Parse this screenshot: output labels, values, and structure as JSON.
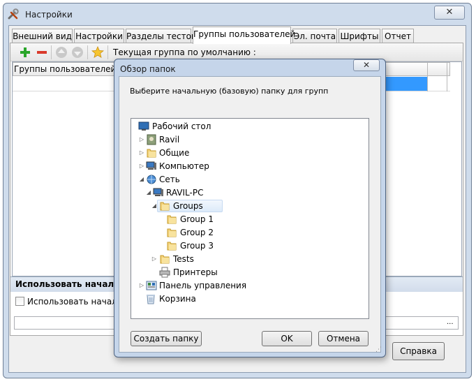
{
  "window": {
    "title": "Настройки",
    "close_label": "✕"
  },
  "tabs": [
    {
      "label": "Внешний вид"
    },
    {
      "label": "Настройки"
    },
    {
      "label": "Разделы тестов"
    },
    {
      "label": "Группы пользователей"
    },
    {
      "label": "Эл. почта"
    },
    {
      "label": "Шрифты"
    },
    {
      "label": "Отчет"
    }
  ],
  "active_tab": "Группы пользователей",
  "toolbar": {
    "default_group_label": "Текущая группа по умолчанию   :",
    "icons": [
      "add-icon",
      "remove-icon",
      "move-up-icon",
      "move-down-icon",
      "star-icon"
    ]
  },
  "grid": {
    "header": "Группы пользователей"
  },
  "bottom": {
    "header": "Использовать начальную",
    "checkbox_label": "Использовать начальн",
    "checkbox_checked": false,
    "path_value": "",
    "browse_label": "...",
    "help_label": "Справка"
  },
  "dialog": {
    "title": "Обзор папок",
    "close_label": "✕",
    "message": "Выберите начальную (базовую) папку для групп",
    "tree": [
      {
        "label": "Рабочий стол",
        "icon": "desktop-icon",
        "expander": ""
      },
      {
        "label": "Ravil",
        "icon": "user-folder-icon",
        "expander": "collapsed"
      },
      {
        "label": "Общие",
        "icon": "folder-icon",
        "expander": "collapsed"
      },
      {
        "label": "Компьютер",
        "icon": "computer-icon",
        "expander": "collapsed"
      },
      {
        "label": "Сеть",
        "icon": "network-icon",
        "expander": "expanded"
      },
      {
        "label": "RAVIL-PC",
        "icon": "computer-icon",
        "expander": "expanded"
      },
      {
        "label": "Groups",
        "icon": "folder-icon",
        "expander": "expanded",
        "selected": true
      },
      {
        "label": "Group 1",
        "icon": "folder-icon",
        "expander": ""
      },
      {
        "label": "Group 2",
        "icon": "folder-icon",
        "expander": ""
      },
      {
        "label": "Group 3",
        "icon": "folder-icon",
        "expander": ""
      },
      {
        "label": "Tests",
        "icon": "folder-icon",
        "expander": "collapsed"
      },
      {
        "label": "Принтеры",
        "icon": "printer-icon",
        "expander": ""
      },
      {
        "label": "Панель управления",
        "icon": "control-panel-icon",
        "expander": "collapsed"
      },
      {
        "label": "Корзина",
        "icon": "recycle-bin-icon",
        "expander": ""
      }
    ],
    "new_folder_label": "Создать папку",
    "ok_label": "OK",
    "cancel_label": "Отмена"
  },
  "colors": {
    "selection": "#3399ff",
    "window_frame": "#cfdcec",
    "dialog_frame": "#c5d5ea"
  }
}
